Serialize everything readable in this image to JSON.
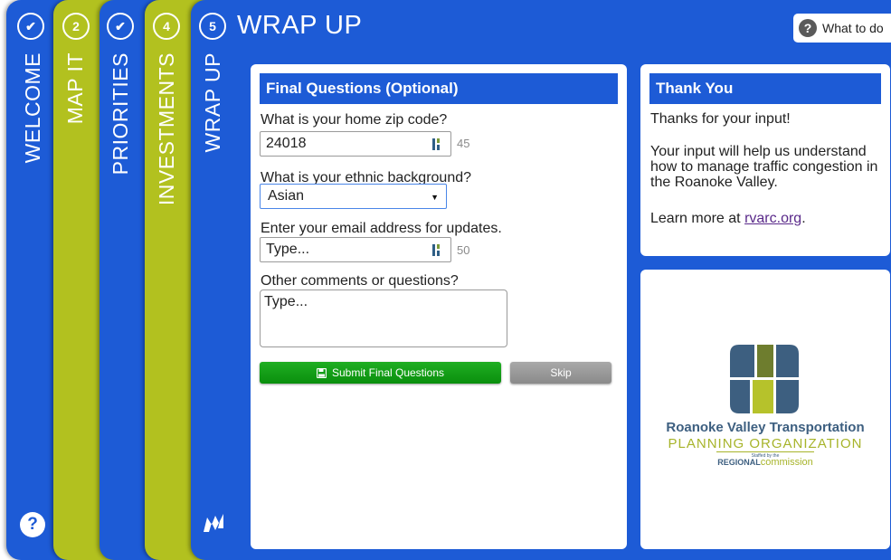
{
  "tabs": [
    {
      "badge": "✔",
      "label": "WELCOME",
      "color": "#1d5bd6"
    },
    {
      "badge": "2",
      "label": "MAP IT",
      "color": "#b2c11f"
    },
    {
      "badge": "✔",
      "label": "PRIORITIES",
      "color": "#1d5bd6"
    },
    {
      "badge": "4",
      "label": "INVESTMENTS",
      "color": "#b2c11f"
    },
    {
      "badge": "5",
      "label": "WRAP UP",
      "color": "#1d5bd6"
    }
  ],
  "page_title": "WRAP UP",
  "help_button": {
    "label": "What to do",
    "icon": "question-circle-icon"
  },
  "final_questions": {
    "title": "Final Questions (Optional)",
    "zip": {
      "label": "What is your home zip code?",
      "value": "24018",
      "count": "45"
    },
    "ethnic": {
      "label": "What is your ethnic background?",
      "value": "Asian"
    },
    "email": {
      "label": "Enter your email address for updates.",
      "placeholder": "Type...",
      "count": "50"
    },
    "comments": {
      "label": "Other comments or questions?",
      "placeholder": "Type..."
    },
    "submit_label": "Submit Final Questions",
    "skip_label": "Skip"
  },
  "thank_you": {
    "title": "Thank You",
    "line1": "Thanks for your input!",
    "line2": "Your input will help us understand how to manage traffic congestion in the Roanoke Valley.",
    "learn_prefix": "Learn more at ",
    "learn_link": "rvarc.org",
    "learn_suffix": "."
  },
  "logo": {
    "line1": "Roanoke Valley Transportation",
    "line2": "PLANNING ORGANIZATION",
    "staffed": "Staffed by the",
    "regional": "REGIONAL",
    "commission": "commission"
  },
  "colors": {
    "primary_blue": "#1d5bd6",
    "lime": "#b2c11f",
    "submit_green": "#12a015",
    "skip_gray": "#999999"
  }
}
